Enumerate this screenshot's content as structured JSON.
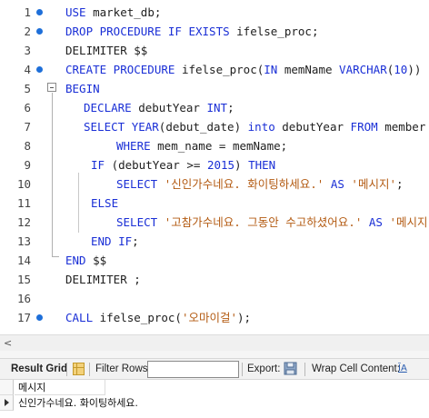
{
  "editor": {
    "lines": [
      {
        "num": "1",
        "bp": true,
        "tokens": [
          {
            "t": "USE ",
            "c": "kw"
          },
          {
            "t": "market_db;",
            "c": "plain"
          }
        ]
      },
      {
        "num": "2",
        "bp": true,
        "tokens": [
          {
            "t": "DROP PROCEDURE IF EXISTS ",
            "c": "kw"
          },
          {
            "t": "ifelse_proc;",
            "c": "plain"
          }
        ]
      },
      {
        "num": "3",
        "bp": false,
        "tokens": [
          {
            "t": "DELIMITER $$",
            "c": "plain"
          }
        ]
      },
      {
        "num": "4",
        "bp": true,
        "tokens": [
          {
            "t": "CREATE PROCEDURE ",
            "c": "kw"
          },
          {
            "t": "ifelse_proc(",
            "c": "plain"
          },
          {
            "t": "IN ",
            "c": "kw"
          },
          {
            "t": "memName ",
            "c": "plain"
          },
          {
            "t": "VARCHAR",
            "c": "kw"
          },
          {
            "t": "(",
            "c": "plain"
          },
          {
            "t": "10",
            "c": "num"
          },
          {
            "t": "))",
            "c": "plain"
          }
        ]
      },
      {
        "num": "5",
        "bp": false,
        "tokens": [
          {
            "t": "BEGIN",
            "c": "kw"
          }
        ]
      },
      {
        "num": "6",
        "bp": false,
        "tokens": [
          {
            "t": "DECLARE ",
            "c": "kw"
          },
          {
            "t": "debutYear ",
            "c": "plain"
          },
          {
            "t": "INT",
            "c": "kw"
          },
          {
            "t": ";",
            "c": "plain"
          }
        ]
      },
      {
        "num": "7",
        "bp": false,
        "tokens": [
          {
            "t": "SELECT ",
            "c": "kw"
          },
          {
            "t": "YEAR",
            "c": "fn"
          },
          {
            "t": "(debut_date) ",
            "c": "plain"
          },
          {
            "t": "into ",
            "c": "kw"
          },
          {
            "t": "debutYear ",
            "c": "plain"
          },
          {
            "t": "FROM ",
            "c": "kw"
          },
          {
            "t": "member",
            "c": "plain"
          }
        ]
      },
      {
        "num": "8",
        "bp": false,
        "tokens": [
          {
            "t": "WHERE ",
            "c": "kw"
          },
          {
            "t": "mem_name = memName;",
            "c": "plain"
          }
        ]
      },
      {
        "num": "9",
        "bp": false,
        "tokens": [
          {
            "t": "IF ",
            "c": "kw"
          },
          {
            "t": "(debutYear >= ",
            "c": "plain"
          },
          {
            "t": "2015",
            "c": "num"
          },
          {
            "t": ") ",
            "c": "plain"
          },
          {
            "t": "THEN",
            "c": "kw"
          }
        ]
      },
      {
        "num": "10",
        "bp": false,
        "tokens": [
          {
            "t": "SELECT ",
            "c": "kw"
          },
          {
            "t": "'신인가수네요. 화이팅하세요.' ",
            "c": "str"
          },
          {
            "t": "AS ",
            "c": "kw"
          },
          {
            "t": "'메시지'",
            "c": "str"
          },
          {
            "t": ";",
            "c": "plain"
          }
        ]
      },
      {
        "num": "11",
        "bp": false,
        "tokens": [
          {
            "t": "ELSE",
            "c": "kw"
          }
        ]
      },
      {
        "num": "12",
        "bp": false,
        "tokens": [
          {
            "t": "SELECT ",
            "c": "kw"
          },
          {
            "t": "'고참가수네요. 그동안 수고하셨어요.' ",
            "c": "str"
          },
          {
            "t": "AS ",
            "c": "kw"
          },
          {
            "t": "'메시지'",
            "c": "str"
          },
          {
            "t": ";",
            "c": "plain"
          }
        ]
      },
      {
        "num": "13",
        "bp": false,
        "tokens": [
          {
            "t": "END IF",
            "c": "kw"
          },
          {
            "t": ";",
            "c": "plain"
          }
        ]
      },
      {
        "num": "14",
        "bp": false,
        "tokens": [
          {
            "t": "END ",
            "c": "kw"
          },
          {
            "t": "$$",
            "c": "plain"
          }
        ]
      },
      {
        "num": "15",
        "bp": false,
        "tokens": [
          {
            "t": "DELIMITER ;",
            "c": "plain"
          }
        ]
      },
      {
        "num": "16",
        "bp": false,
        "tokens": []
      },
      {
        "num": "17",
        "bp": true,
        "tokens": [
          {
            "t": "CALL ",
            "c": "kw"
          },
          {
            "t": "ifelse_proc(",
            "c": "plain"
          },
          {
            "t": "'오마이걸'",
            "c": "str"
          },
          {
            "t": ");",
            "c": "plain"
          }
        ]
      }
    ]
  },
  "scrollbar": {
    "left_arrow": "<"
  },
  "toolbar": {
    "result_grid_label": "Result Grid",
    "filter_rows_label": "Filter Rows:",
    "filter_rows_value": "",
    "export_label": "Export:",
    "wrap_label": "Wrap Cell Content:",
    "wrap_icon": "ĪA"
  },
  "grid": {
    "column_header": "메시지",
    "rows": [
      "신인가수네요. 화이팅하세요."
    ]
  },
  "colors": {
    "keyword": "#1a2fd6",
    "string": "#b35a11",
    "breakpoint": "#1e6fd9"
  }
}
